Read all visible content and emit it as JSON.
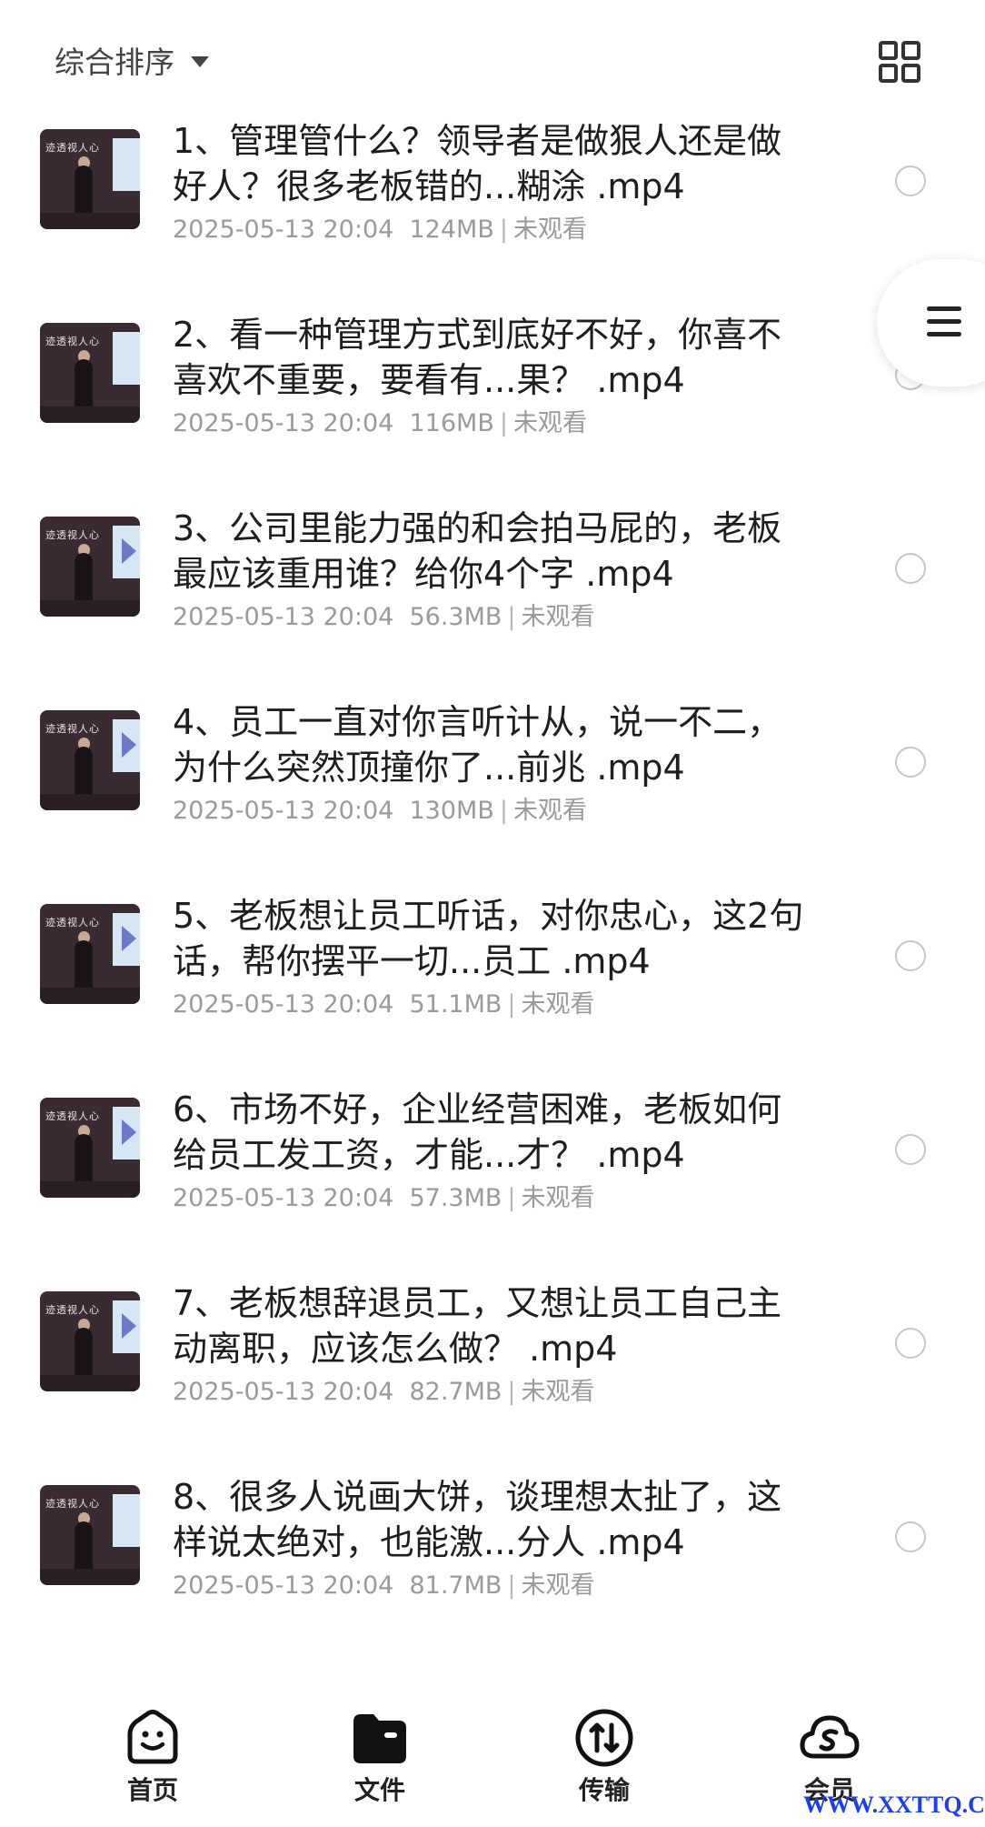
{
  "header": {
    "sort_label": "综合排序"
  },
  "files": [
    {
      "title": "1、管理管什么？领导者是做狠人还是做好人？很多老板错的...糊涂 .mp4",
      "date": "2025-05-13 20:04",
      "size": "124MB",
      "status": "未观看"
    },
    {
      "title": "2、看一种管理方式到底好不好，你喜不喜欢不重要，要看有...果？ .mp4",
      "date": "2025-05-13 20:04",
      "size": "116MB",
      "status": "未观看"
    },
    {
      "title": "3、公司里能力强的和会拍马屁的，老板最应该重用谁？给你4个字 .mp4",
      "date": "2025-05-13 20:04",
      "size": "56.3MB",
      "status": "未观看"
    },
    {
      "title": "4、员工一直对你言听计从，说一不二，为什么突然顶撞你了...前兆 .mp4",
      "date": "2025-05-13 20:04",
      "size": "130MB",
      "status": "未观看"
    },
    {
      "title": "5、老板想让员工听话，对你忠心，这2句话，帮你摆平一切...员工 .mp4",
      "date": "2025-05-13 20:04",
      "size": "51.1MB",
      "status": "未观看"
    },
    {
      "title": "6、市场不好，企业经营困难，老板如何给员工发工资，才能...才？ .mp4",
      "date": "2025-05-13 20:04",
      "size": "57.3MB",
      "status": "未观看"
    },
    {
      "title": "7、老板想辞退员工，又想让员工自己主动离职，应该怎么做？ .mp4",
      "date": "2025-05-13 20:04",
      "size": "82.7MB",
      "status": "未观看"
    },
    {
      "title": "8、很多人说画大饼，谈理想太扯了，这样说太绝对，也能激...分人 .mp4",
      "date": "2025-05-13 20:04",
      "size": "81.7MB",
      "status": "未观看"
    }
  ],
  "thumb_banner": "迹透视人心",
  "tabs": [
    {
      "label": "首页",
      "icon": "smiley-home-icon"
    },
    {
      "label": "文件",
      "icon": "folder-icon"
    },
    {
      "label": "传输",
      "icon": "transfer-icon"
    },
    {
      "label": "会员",
      "icon": "vip-cloud-icon"
    }
  ],
  "watermark": "WWW.XXTTQ.COM",
  "colors": {
    "accent": "#1f1f1f",
    "meta": "#9a9a9a",
    "watermark": "#1e3cf0"
  }
}
